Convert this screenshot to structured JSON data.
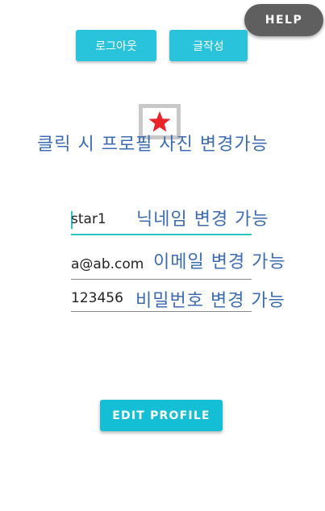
{
  "help_label": "HELP",
  "buttons": {
    "logout": "로그아웃",
    "write": "글작성",
    "edit_profile": "EDIT PROFILE"
  },
  "profile_photo": {
    "icon": "star-icon",
    "star_color": "#e8232a"
  },
  "annotations": {
    "photo": "클릭 시 프로필 사진 변경가능",
    "nickname": "닉네임 변경 가능",
    "email": "이메일 변경 가능",
    "password": "비밀번호 변경 가능"
  },
  "fields": {
    "nickname": "star1",
    "email": "a@ab.com",
    "password": "123456"
  },
  "colors": {
    "accent": "#29c3db",
    "annotation": "#3b6cb3",
    "help_bg": "#5f5f5f"
  }
}
